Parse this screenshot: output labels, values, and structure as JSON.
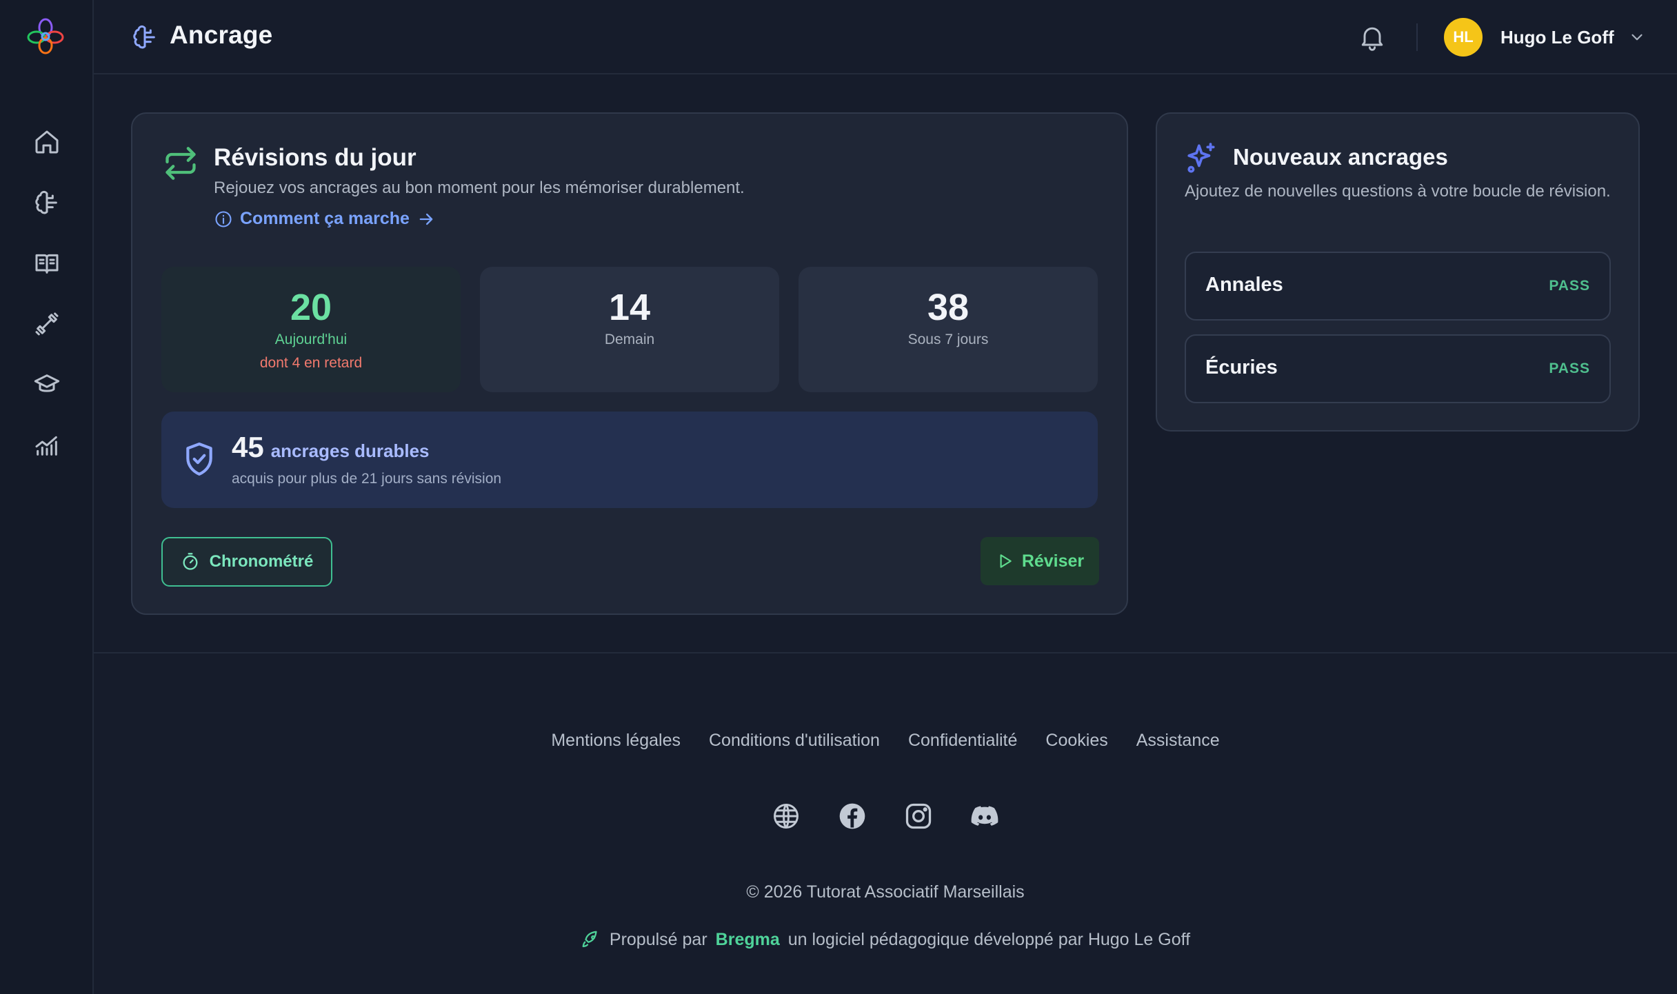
{
  "header": {
    "title": "Ancrage",
    "user": {
      "initials": "HL",
      "name": "Hugo Le Goff",
      "avatar_color": "#f5c518"
    }
  },
  "sidebar": {
    "items": [
      {
        "icon": "home-icon"
      },
      {
        "icon": "brain-icon"
      },
      {
        "icon": "book-icon"
      },
      {
        "icon": "dumbbell-icon"
      },
      {
        "icon": "graduation-cap-icon"
      },
      {
        "icon": "chart-icon"
      }
    ]
  },
  "reviews": {
    "title": "Révisions du jour",
    "subtitle": "Rejouez vos ancrages au bon moment pour les mémoriser durablement.",
    "how_link": "Comment ça marche",
    "stats": {
      "today": {
        "value": "20",
        "label": "Aujourd'hui",
        "late": "dont 4 en retard"
      },
      "tomorrow": {
        "value": "14",
        "label": "Demain"
      },
      "week": {
        "value": "38",
        "label": "Sous 7 jours"
      }
    },
    "durable": {
      "value": "45",
      "label": "ancrages durables",
      "sub": "acquis pour plus de 21 jours sans révision"
    },
    "timed_button": "Chronométré",
    "review_button": "Réviser"
  },
  "new_anchors": {
    "title": "Nouveaux ancrages",
    "subtitle": "Ajoutez de nouvelles questions à votre boucle de révision.",
    "decks": [
      {
        "name": "Annales",
        "tag": "PASS"
      },
      {
        "name": "Écuries",
        "tag": "PASS"
      }
    ]
  },
  "footer": {
    "links": [
      "Mentions légales",
      "Conditions d'utilisation",
      "Confidentialité",
      "Cookies",
      "Assistance"
    ],
    "socials": [
      "globe-icon",
      "facebook-icon",
      "instagram-icon",
      "discord-icon"
    ],
    "copyright": "© 2026 Tutorat Associatif Marseillais",
    "powered_prefix": "Propulsé par",
    "powered_brand": "Bregma",
    "powered_suffix": "un logiciel pédagogique développé par Hugo Le Goff"
  },
  "colors": {
    "accent_green": "#4fbf7a",
    "accent_blue": "#7aa3ff",
    "late_red": "#f27a6e",
    "background": "#161c2b"
  }
}
